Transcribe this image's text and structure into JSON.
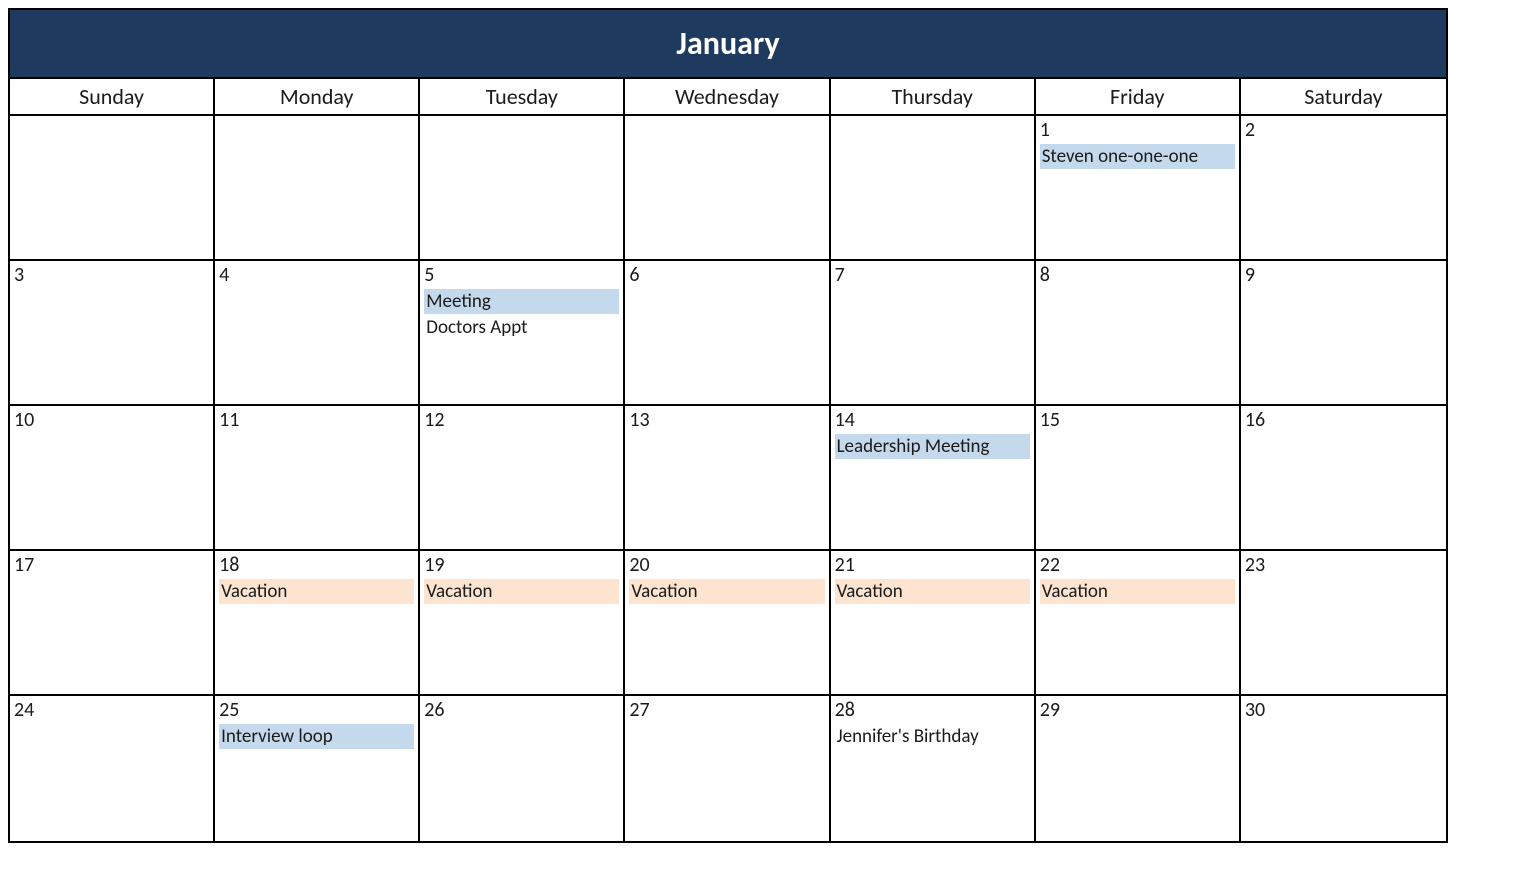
{
  "month_title": "January",
  "weekdays": [
    "Sunday",
    "Monday",
    "Tuesday",
    "Wednesday",
    "Thursday",
    "Friday",
    "Saturday"
  ],
  "colors": {
    "header_bg": "#1f3a5f",
    "event_blue": "#c5d9ed",
    "event_orange": "#fce4d1"
  },
  "weeks": [
    [
      {
        "day": "",
        "events": []
      },
      {
        "day": "",
        "events": []
      },
      {
        "day": "",
        "events": []
      },
      {
        "day": "",
        "events": []
      },
      {
        "day": "",
        "events": []
      },
      {
        "day": "1",
        "events": [
          {
            "label": "Steven one-one-one",
            "color": "blue"
          }
        ]
      },
      {
        "day": "2",
        "events": []
      }
    ],
    [
      {
        "day": "3",
        "events": []
      },
      {
        "day": "4",
        "events": []
      },
      {
        "day": "5",
        "events": [
          {
            "label": "Meeting",
            "color": "blue"
          },
          {
            "label": "Doctors Appt",
            "color": "plain"
          }
        ]
      },
      {
        "day": "6",
        "events": []
      },
      {
        "day": "7",
        "events": []
      },
      {
        "day": "8",
        "events": []
      },
      {
        "day": "9",
        "events": []
      }
    ],
    [
      {
        "day": "10",
        "events": []
      },
      {
        "day": "11",
        "events": []
      },
      {
        "day": "12",
        "events": []
      },
      {
        "day": "13",
        "events": []
      },
      {
        "day": "14",
        "events": [
          {
            "label": "Leadership Meeting",
            "color": "blue"
          }
        ]
      },
      {
        "day": "15",
        "events": []
      },
      {
        "day": "16",
        "events": []
      }
    ],
    [
      {
        "day": "17",
        "events": []
      },
      {
        "day": "18",
        "events": [
          {
            "label": "Vacation",
            "color": "orange"
          }
        ]
      },
      {
        "day": "19",
        "events": [
          {
            "label": "Vacation",
            "color": "orange"
          }
        ]
      },
      {
        "day": "20",
        "events": [
          {
            "label": "Vacation",
            "color": "orange"
          }
        ]
      },
      {
        "day": "21",
        "events": [
          {
            "label": "Vacation",
            "color": "orange"
          }
        ]
      },
      {
        "day": "22",
        "events": [
          {
            "label": "Vacation",
            "color": "orange"
          }
        ]
      },
      {
        "day": "23",
        "events": []
      }
    ],
    [
      {
        "day": "24",
        "events": []
      },
      {
        "day": "25",
        "events": [
          {
            "label": "Interview loop",
            "color": "blue"
          }
        ]
      },
      {
        "day": "26",
        "events": []
      },
      {
        "day": "27",
        "events": []
      },
      {
        "day": "28",
        "events": [
          {
            "label": "Jennifer's Birthday",
            "color": "plain"
          }
        ]
      },
      {
        "day": "29",
        "events": []
      },
      {
        "day": "30",
        "events": []
      }
    ]
  ]
}
